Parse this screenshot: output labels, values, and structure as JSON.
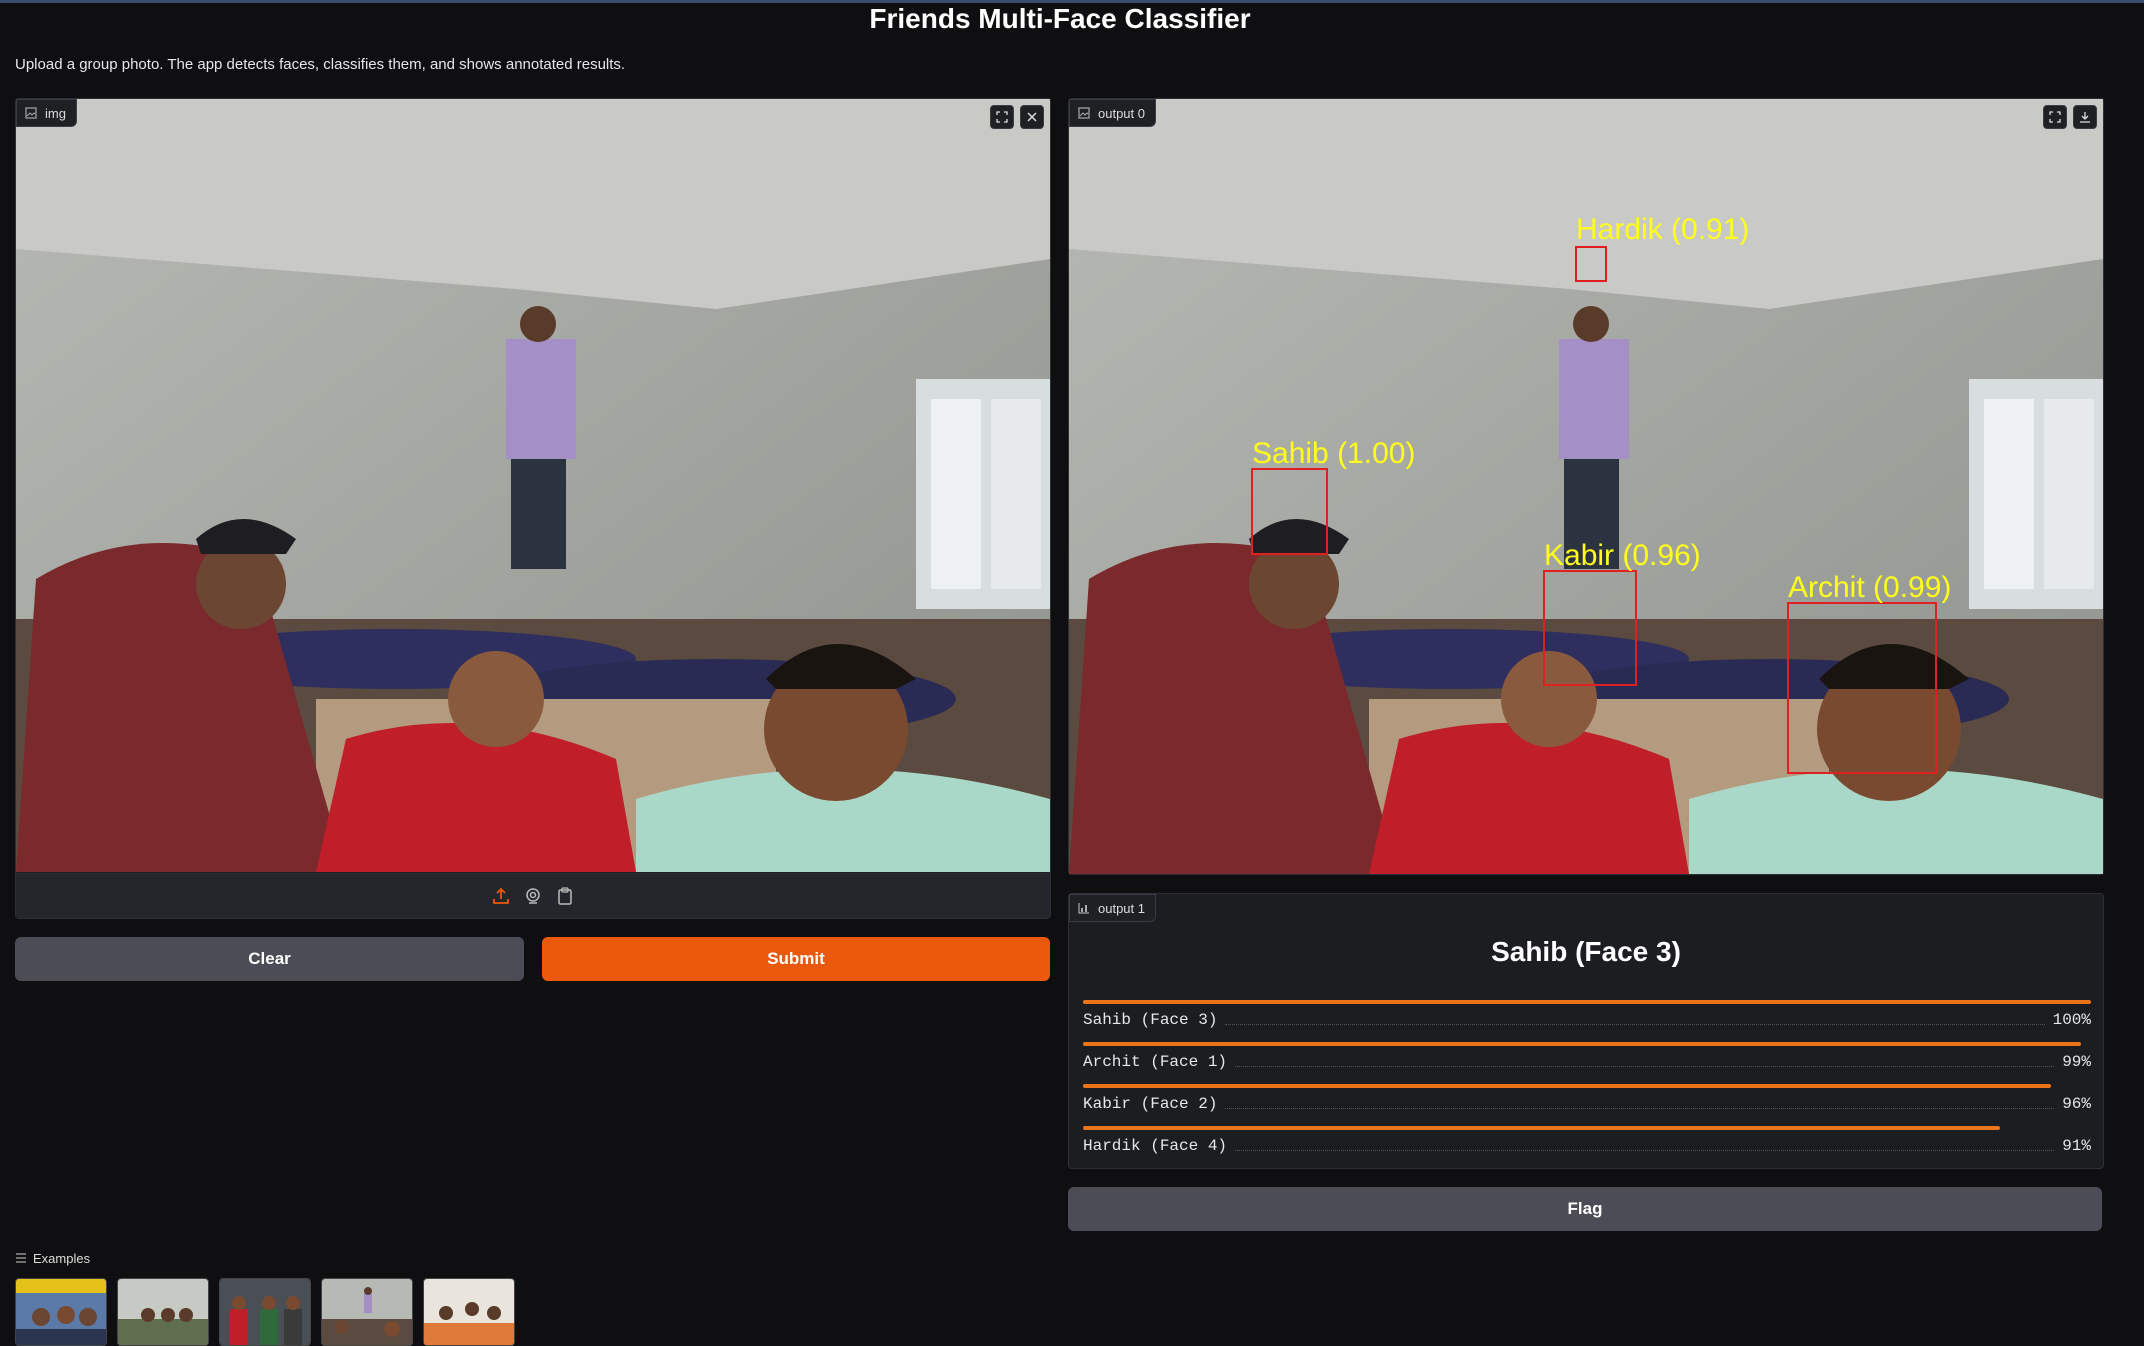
{
  "app": {
    "title": "Friends Multi-Face Classifier",
    "description": "Upload a group photo. The app detects faces, classifies them, and shows annotated results."
  },
  "input_panel": {
    "label": "img",
    "tools": [
      "fullscreen-icon",
      "close-icon"
    ],
    "source_icons": [
      "upload-icon",
      "webcam-icon",
      "clipboard-icon"
    ]
  },
  "output0": {
    "label": "output 0",
    "tools": [
      "fullscreen-icon",
      "download-icon"
    ],
    "detections": [
      {
        "text": "Hardik (0.91)"
      },
      {
        "text": "Sahib (1.00)"
      },
      {
        "text": "Kabir (0.96)"
      },
      {
        "text": "Archit (0.99)"
      }
    ]
  },
  "output1": {
    "label": "output 1",
    "top_label": "Sahib (Face 3)",
    "confidences": [
      {
        "name": "Sahib (Face 3)",
        "pct": "100%",
        "value": 1.0
      },
      {
        "name": "Archit (Face 1)",
        "pct": "99%",
        "value": 0.99
      },
      {
        "name": "Kabir (Face 2)",
        "pct": "96%",
        "value": 0.96
      },
      {
        "name": "Hardik (Face 4)",
        "pct": "91%",
        "value": 0.91
      }
    ]
  },
  "buttons": {
    "clear": "Clear",
    "submit": "Submit",
    "flag": "Flag"
  },
  "examples": {
    "label": "Examples",
    "count": 5
  },
  "colors": {
    "accent": "#ea580c",
    "secondary_button": "#4b4c55",
    "background": "#0f0f11",
    "detection_box": "#e02020",
    "detection_text": "#ffff1a"
  }
}
